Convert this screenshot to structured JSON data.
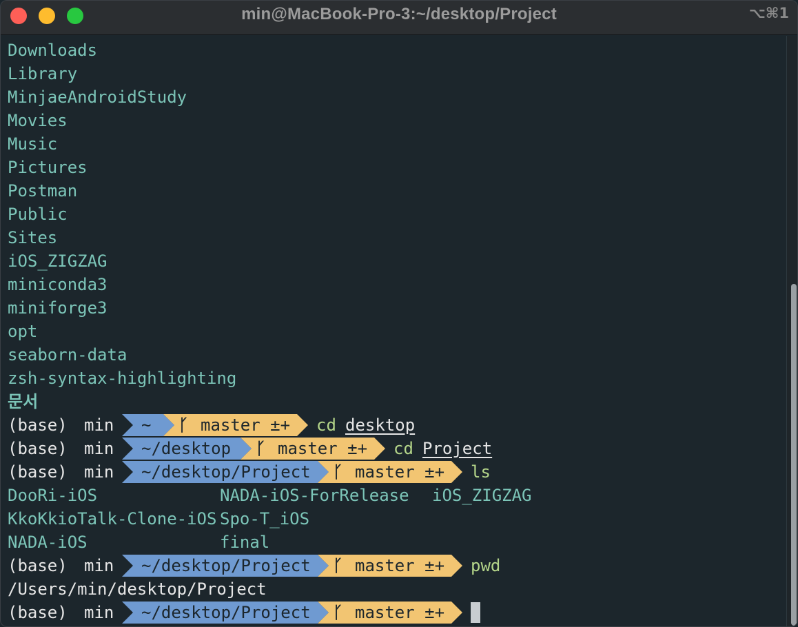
{
  "window": {
    "title": "min@MacBook-Pro-3:~/desktop/Project",
    "shortcut": "⌥⌘1"
  },
  "listing": [
    "Downloads",
    "Library",
    "MinjaeAndroidStudy",
    "Movies",
    "Music",
    "Pictures",
    "Postman",
    "Public",
    "Sites",
    "iOS_ZIGZAG",
    "miniconda3",
    "miniforge3",
    "opt",
    "seaborn-data",
    "zsh-syntax-highlighting",
    "문서"
  ],
  "prompts": [
    {
      "env": "(base)",
      "user": "min",
      "path": "~",
      "branch": "master ±+",
      "command": "cd",
      "argument": "desktop"
    },
    {
      "env": "(base)",
      "user": "min",
      "path": "~/desktop",
      "branch": "master ±+",
      "command": "cd",
      "argument": "Project"
    },
    {
      "env": "(base)",
      "user": "min",
      "path": "~/desktop/Project",
      "branch": "master ±+",
      "command": "ls",
      "argument": ""
    },
    {
      "env": "(base)",
      "user": "min",
      "path": "~/desktop/Project",
      "branch": "master ±+",
      "command": "pwd",
      "argument": ""
    },
    {
      "env": "(base)",
      "user": "min",
      "path": "~/desktop/Project",
      "branch": "master ±+",
      "command": "",
      "argument": ""
    }
  ],
  "ls_output": {
    "col1": [
      "DooRi-iOS",
      "KkoKkioTalk-Clone-iOS",
      "NADA-iOS"
    ],
    "col2": [
      "NADA-iOS-ForRelease",
      "Spo-T_iOS",
      "final"
    ],
    "col3": [
      "iOS_ZIGZAG"
    ]
  },
  "pwd_output": "/Users/min/desktop/Project",
  "icons": {
    "branch": "git-branch-icon"
  },
  "colors": {
    "background": "#1c262c",
    "directory": "#7cc5b8",
    "path_segment": "#6f9ad1",
    "git_segment": "#f2c572",
    "command": "#b5d68a"
  }
}
